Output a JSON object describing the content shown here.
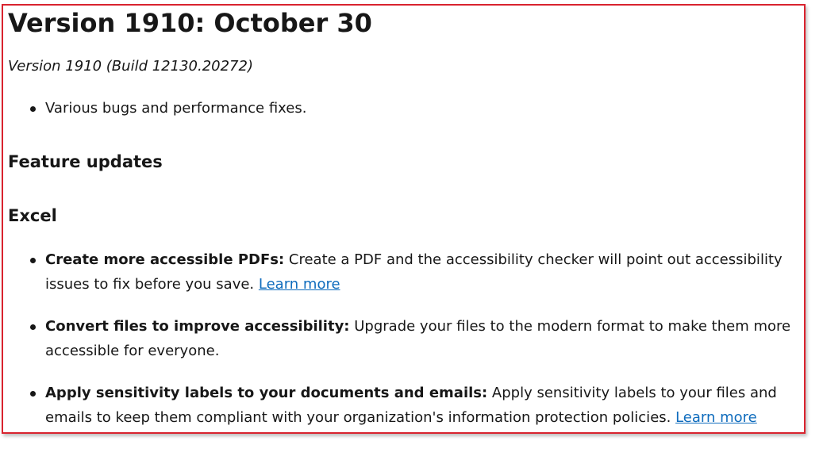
{
  "heading": "Version 1910: October 30",
  "version_line": "Version 1910 (Build 12130.20272)",
  "general_items": [
    "Various bugs and performance fixes."
  ],
  "feature_updates_heading": "Feature updates",
  "excel_heading": "Excel",
  "excel_items": [
    {
      "title": "Create more accessible PDFs:",
      "text": " Create a PDF and the accessibility checker will point out accessibility issues to fix before you save. ",
      "link": "Learn more"
    },
    {
      "title": "Convert files to improve accessibility:",
      "text": " Upgrade your files to the modern format to make them more accessible for everyone.",
      "link": ""
    },
    {
      "title": "Apply sensitivity labels to your documents and emails:",
      "text": " Apply sensitivity labels to your files and emails to keep them compliant with your organization's information protection policies. ",
      "link": "Learn more"
    }
  ],
  "colors": {
    "frame_border": "#d9232e",
    "link": "#0f6cbd",
    "text": "#171717"
  }
}
